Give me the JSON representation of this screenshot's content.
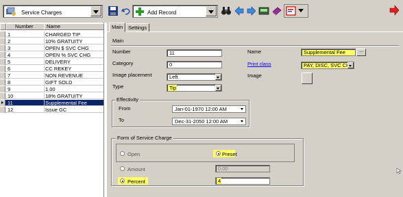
{
  "toolbar": {
    "service_combo": "Service Charges",
    "add_record_combo": "Add Record",
    "icons": [
      "service-charges-icon",
      "save-icon",
      "undo-icon",
      "add-icon",
      "binoculars-icon",
      "back-arrow-icon",
      "forward-arrow-icon",
      "terminal-icon",
      "book-icon",
      "report-icon",
      "exit-arrow-icon"
    ]
  },
  "list": {
    "headers": [
      "Number",
      "Name"
    ],
    "rows": [
      {
        "num": "1",
        "name": "CHARGED TIP"
      },
      {
        "num": "2",
        "name": "10% GRATUITY"
      },
      {
        "num": "3",
        "name": "OPEN $ SVC CHG"
      },
      {
        "num": "4",
        "name": "OPEN % SVC CHG"
      },
      {
        "num": "5",
        "name": "DELIVERY"
      },
      {
        "num": "6",
        "name": "CC REKEY"
      },
      {
        "num": "7",
        "name": "NON REVENUE"
      },
      {
        "num": "8",
        "name": "GIFT SOLD"
      },
      {
        "num": "9",
        "name": "1.00"
      },
      {
        "num": "10",
        "name": "18% GRATUITY"
      },
      {
        "num": "11",
        "name": "Supplemental Fee"
      },
      {
        "num": "12",
        "name": "Issue GC"
      }
    ]
  },
  "tabs": [
    "Main",
    "Settings"
  ],
  "form": {
    "section_label": "Main",
    "number_label": "Number",
    "number_value": "11",
    "category_label": "Category",
    "category_value": "0",
    "image_placement_label": "Image placement",
    "image_placement_value": "Left",
    "type_label": "Type",
    "type_value": "Tip",
    "name_label": "Name",
    "name_value": "Supplemental Fee",
    "name_button": "...",
    "print_class_label": "Print class",
    "print_class_value": "PAY, DISC, SVC CH",
    "image_label": "Image"
  },
  "effectivity": {
    "title": "Effectivity",
    "from_label": "From",
    "from_value": "Jan-01-1970 12:00 AM",
    "to_label": "To",
    "to_value": "Dec-31-2050 12:00 AM"
  },
  "service_form": {
    "title": "Form of Service Charge",
    "open_label": "Open",
    "preset_label": "Preset",
    "amount_label": "Amount",
    "amount_value": "0.00",
    "percent_label": "Percent",
    "percent_value": "4"
  },
  "colors": {
    "highlight": "#ffff66",
    "selection": "#0a246a",
    "face": "#d4d0c8"
  }
}
